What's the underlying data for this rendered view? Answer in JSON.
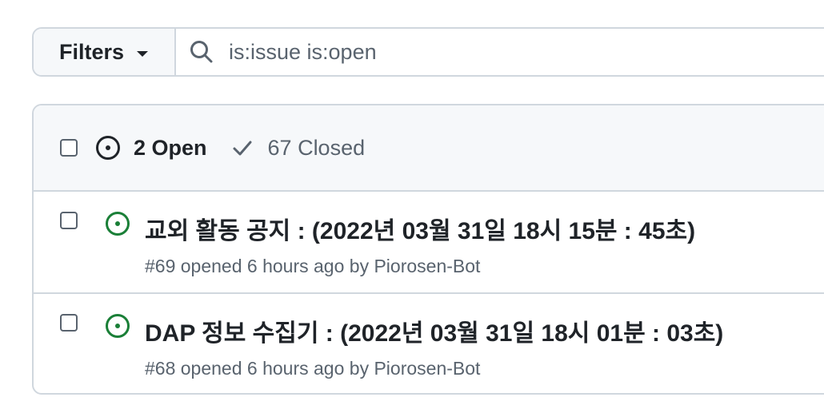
{
  "toolbar": {
    "filters_label": "Filters",
    "search_value": "is:issue is:open"
  },
  "issues_header": {
    "open_label": "2 Open",
    "closed_label": "67 Closed"
  },
  "issues": [
    {
      "title": "교외 활동 공지 : (2022년 03월 31일 18시 15분 : 45초)",
      "number": "#69",
      "opened": "opened 6 hours ago by",
      "author": "Piorosen-Bot"
    },
    {
      "title": "DAP 정보 수집기 : (2022년 03월 31일 18시 01분 : 03초)",
      "number": "#68",
      "opened": "opened 6 hours ago by",
      "author": "Piorosen-Bot"
    }
  ],
  "colors": {
    "open_green": "#1a7f37",
    "border": "#d0d7de",
    "header_bg": "#f6f8fa",
    "muted_text": "#59636e"
  },
  "icons": {
    "filters_caret": "triangle-down-icon",
    "search": "search-icon",
    "open": "issue-opened-icon",
    "closed": "check-icon"
  }
}
